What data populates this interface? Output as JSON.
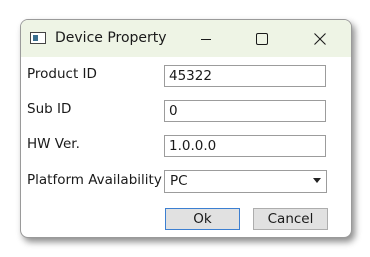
{
  "window": {
    "title": "Device Property"
  },
  "titlebar": {
    "minimize": "minimize-icon",
    "maximize": "maximize-icon",
    "close": "close-icon"
  },
  "form": {
    "product_id": {
      "label": "Product ID",
      "value": "45322"
    },
    "sub_id": {
      "label": "Sub ID",
      "value": "0"
    },
    "hw_ver": {
      "label": "HW Ver.",
      "value": "1.0.0.0"
    },
    "platform": {
      "label": "Platform Availability",
      "value": "PC"
    }
  },
  "buttons": {
    "ok": "Ok",
    "cancel": "Cancel"
  },
  "colors": {
    "titlebar_bg": "#eef4e5",
    "default_button_border": "#3c7fd1"
  }
}
